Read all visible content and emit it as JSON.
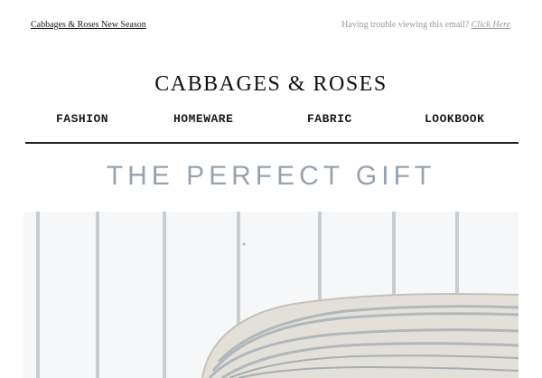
{
  "header": {
    "season_link": "Cabbages & Roses New Season",
    "trouble_text": "Having trouble viewing this email?",
    "trouble_link": "Click Here"
  },
  "brand": {
    "name": "CABBAGES & ROSES"
  },
  "nav": {
    "items": [
      {
        "label": "FASHION"
      },
      {
        "label": "HOMEWARE"
      },
      {
        "label": "FABRIC"
      },
      {
        "label": "LOOKBOOK"
      }
    ]
  },
  "headline": "THE PERFECT GIFT",
  "colors": {
    "headline": "#98a2ad",
    "brand_text": "#111111",
    "muted_text": "#9a9a9a"
  }
}
